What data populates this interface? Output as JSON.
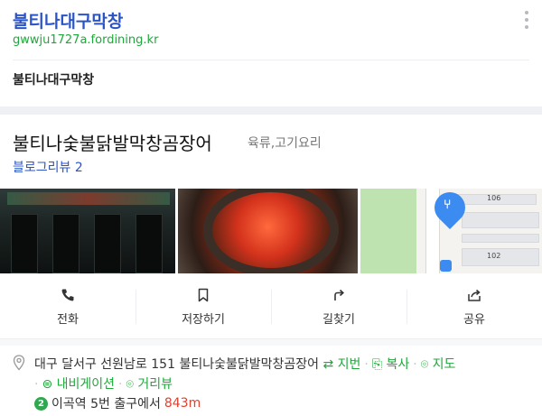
{
  "header_card": {
    "title": "불티나대구막창",
    "url": "gwwju1727a.fordining.kr",
    "subtitle": "불티나대구막창"
  },
  "place": {
    "name": "불티나숯불닭발막창곰장어",
    "category": "육류,고기요리",
    "blog_review": "블로그리뷰 2"
  },
  "map_labels": {
    "n106": "106",
    "n102": "102"
  },
  "actions": [
    {
      "label": "전화",
      "icon": "phone-icon"
    },
    {
      "label": "저장하기",
      "icon": "bookmark-icon"
    },
    {
      "label": "길찾기",
      "icon": "directions-icon"
    },
    {
      "label": "공유",
      "icon": "share-icon"
    }
  ],
  "address": {
    "text": "대구 달서구 선원남로 151 불티나숯불닭발막창곰장어",
    "jibeon": "지번",
    "copy": "복사",
    "map": "지도",
    "navigation": "내비게이션",
    "street_view": "거리뷰"
  },
  "subway": {
    "line": "2",
    "station": "이곡역",
    "exit_text": "5번 출구에서",
    "distance": "843m"
  },
  "colors": {
    "brand_blue": "#2b55c6",
    "url_green": "#1fa83a",
    "distance_red": "#e0402f",
    "line2_green": "#2fa84f",
    "pin_blue": "#3b8bf0"
  }
}
